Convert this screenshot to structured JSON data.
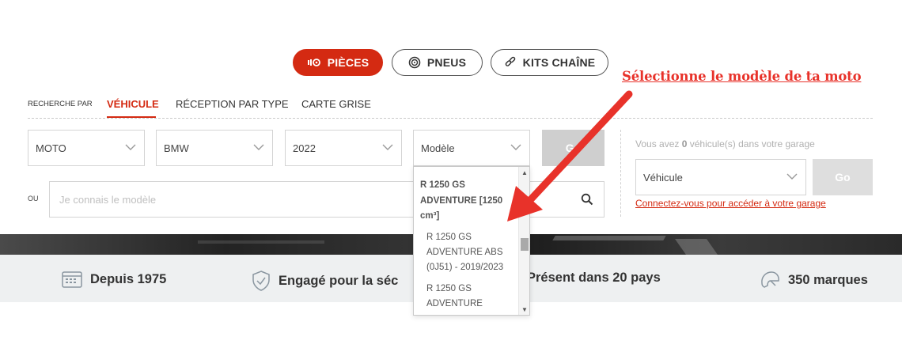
{
  "categories": {
    "pieces": "PIÈCES",
    "pneus": "PNEUS",
    "kits": "KITS CHAÎNE"
  },
  "annotation": "Sélectionne le modèle de ta moto",
  "search_by": {
    "label": "RECHERCHE PAR",
    "tabs": [
      "VÉHICULE",
      "RÉCEPTION PAR TYPE",
      "CARTE GRISE"
    ]
  },
  "selects": {
    "type": "MOTO",
    "brand": "BMW",
    "year": "2022",
    "model": "Modèle"
  },
  "go_label": "Go",
  "or_label": "OU",
  "model_input_placeholder": "Je connais le modèle",
  "dropdown": {
    "group": "R 1250 GS ADVENTURE [1250 cm³]",
    "options": [
      "R 1250 GS ADVENTURE ABS (0J51) - 2019/2023",
      "R 1250 GS ADVENTURE"
    ]
  },
  "garage": {
    "text_before": "Vous avez ",
    "count": "0",
    "text_after": " véhicule(s) dans votre garage",
    "vehicle_select": "Véhicule",
    "go": "Go",
    "login_link": "Connectez-vous pour accéder à votre garage"
  },
  "trust_bar": {
    "since": "Depuis 1975",
    "engaged": "Engagé pour la séc",
    "present": "Présent dans 20 pays",
    "brands": "350 marques"
  },
  "colors": {
    "brand_red": "#d42a12",
    "annotation_red": "#e8322a"
  }
}
